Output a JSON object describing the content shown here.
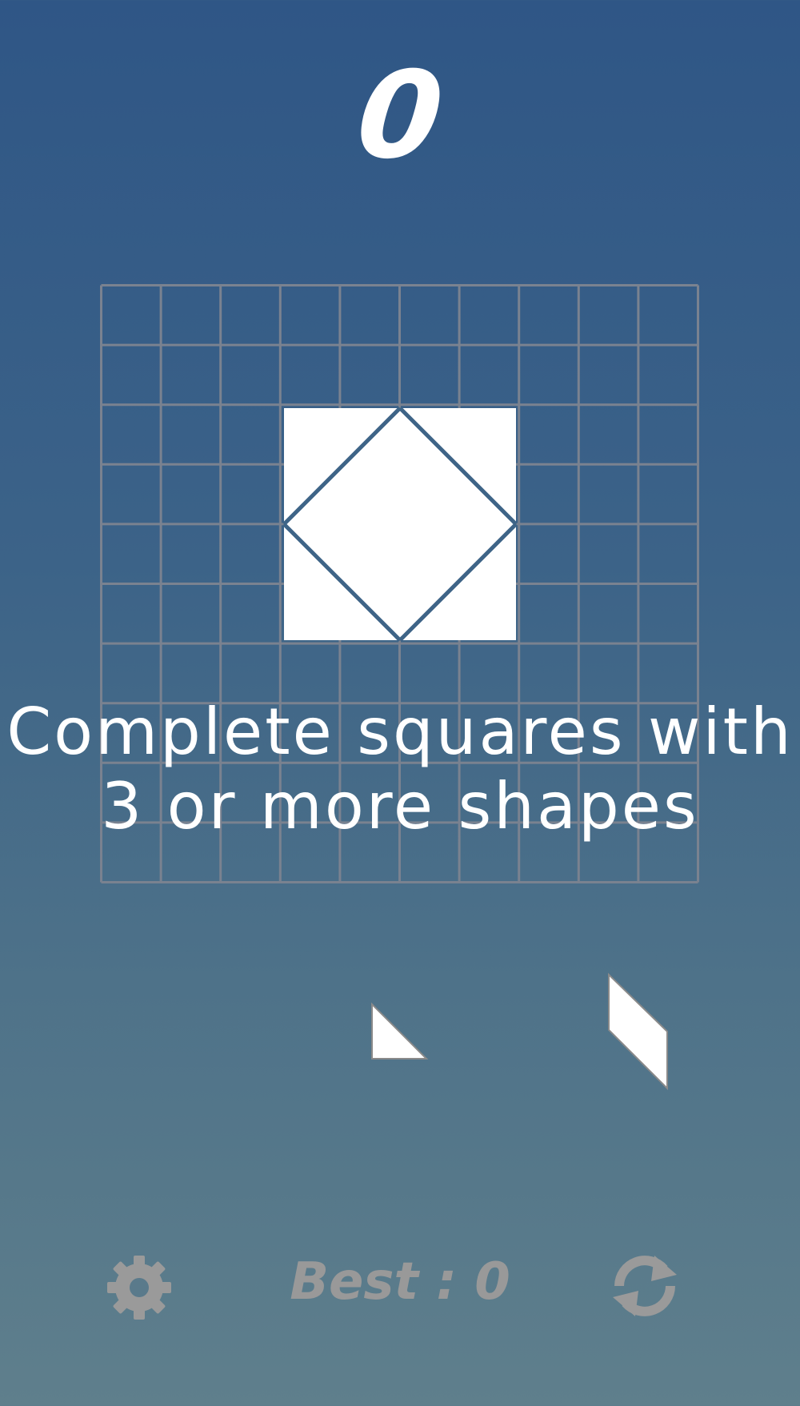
{
  "score": "0",
  "hint": {
    "line1": "Complete squares with",
    "line2": "3 or more shapes"
  },
  "board": {
    "rows": 10,
    "cols": 10
  },
  "tray": {
    "pieces": [
      {
        "shape": "right-triangle"
      },
      {
        "shape": "parallelogram"
      }
    ]
  },
  "footer": {
    "best_label": "Best : 0",
    "settings_icon": "gear-icon",
    "restart_icon": "refresh-icon"
  },
  "colors": {
    "gradient_top": "#2f5686",
    "gradient_bottom": "#5f7f8c",
    "grid_line": "#7a8290",
    "piece_fill": "#ffffff",
    "piece_divider": "#3e6487",
    "footer_icon": "#9a9a9a"
  }
}
